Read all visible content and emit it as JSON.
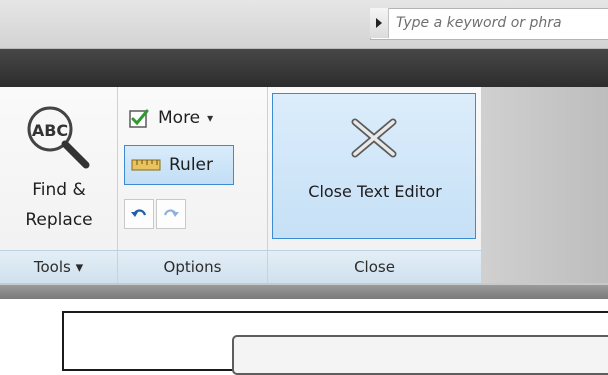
{
  "search": {
    "placeholder": "Type a keyword or phra"
  },
  "ribbon": {
    "tools": {
      "find_label": "Find &\nReplace",
      "panel_title": "Tools ▾"
    },
    "options": {
      "more_label": "More",
      "ruler_label": "Ruler",
      "panel_title": "Options"
    },
    "close": {
      "close_label": "Close Text Editor",
      "panel_title": "Close"
    }
  },
  "icons": {
    "find": "abc-magnifier-icon",
    "more": "checkbox-checked-icon",
    "ruler": "ruler-icon",
    "undo": "undo-icon",
    "redo": "redo-icon",
    "close": "close-x-icon"
  },
  "colors": {
    "accent": "#3d8bd0",
    "panel_title_bg": "#cfe1ee"
  }
}
